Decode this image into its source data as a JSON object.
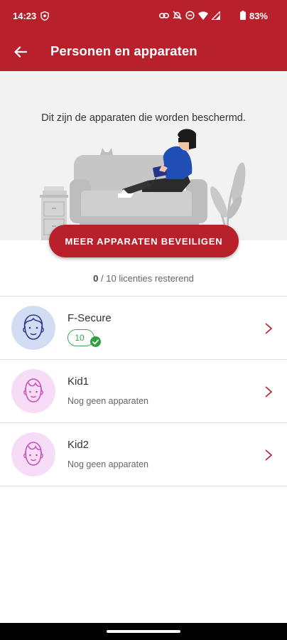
{
  "status_bar": {
    "time": "14:23",
    "battery_percent": "83%",
    "icons": [
      "shield-icon",
      "link-icon",
      "mute-icon",
      "dnd-icon",
      "wifi-icon",
      "signal-icon",
      "battery-icon"
    ]
  },
  "app_bar": {
    "title": "Personen en apparaten",
    "back_icon": "arrow-left-icon"
  },
  "hero": {
    "text": "Dit zijn de apparaten die worden beschermd."
  },
  "cta": {
    "label": "MEER APPARATEN BEVEILIGEN"
  },
  "licenses": {
    "used": "0",
    "rest": " / 10 licenties resterend"
  },
  "people": [
    {
      "name": "F-Secure",
      "device_count": "10",
      "avatar": "adult-face-icon"
    },
    {
      "name": "Kid1",
      "subtitle": "Nog geen apparaten",
      "avatar": "child-face-icon"
    },
    {
      "name": "Kid2",
      "subtitle": "Nog geen apparaten",
      "avatar": "child-face-icon"
    }
  ],
  "colors": {
    "brand_red": "#b8212b",
    "success_green": "#2ea040",
    "avatar_blue": "#d2dcf3",
    "avatar_pink": "#f6dcf7"
  }
}
